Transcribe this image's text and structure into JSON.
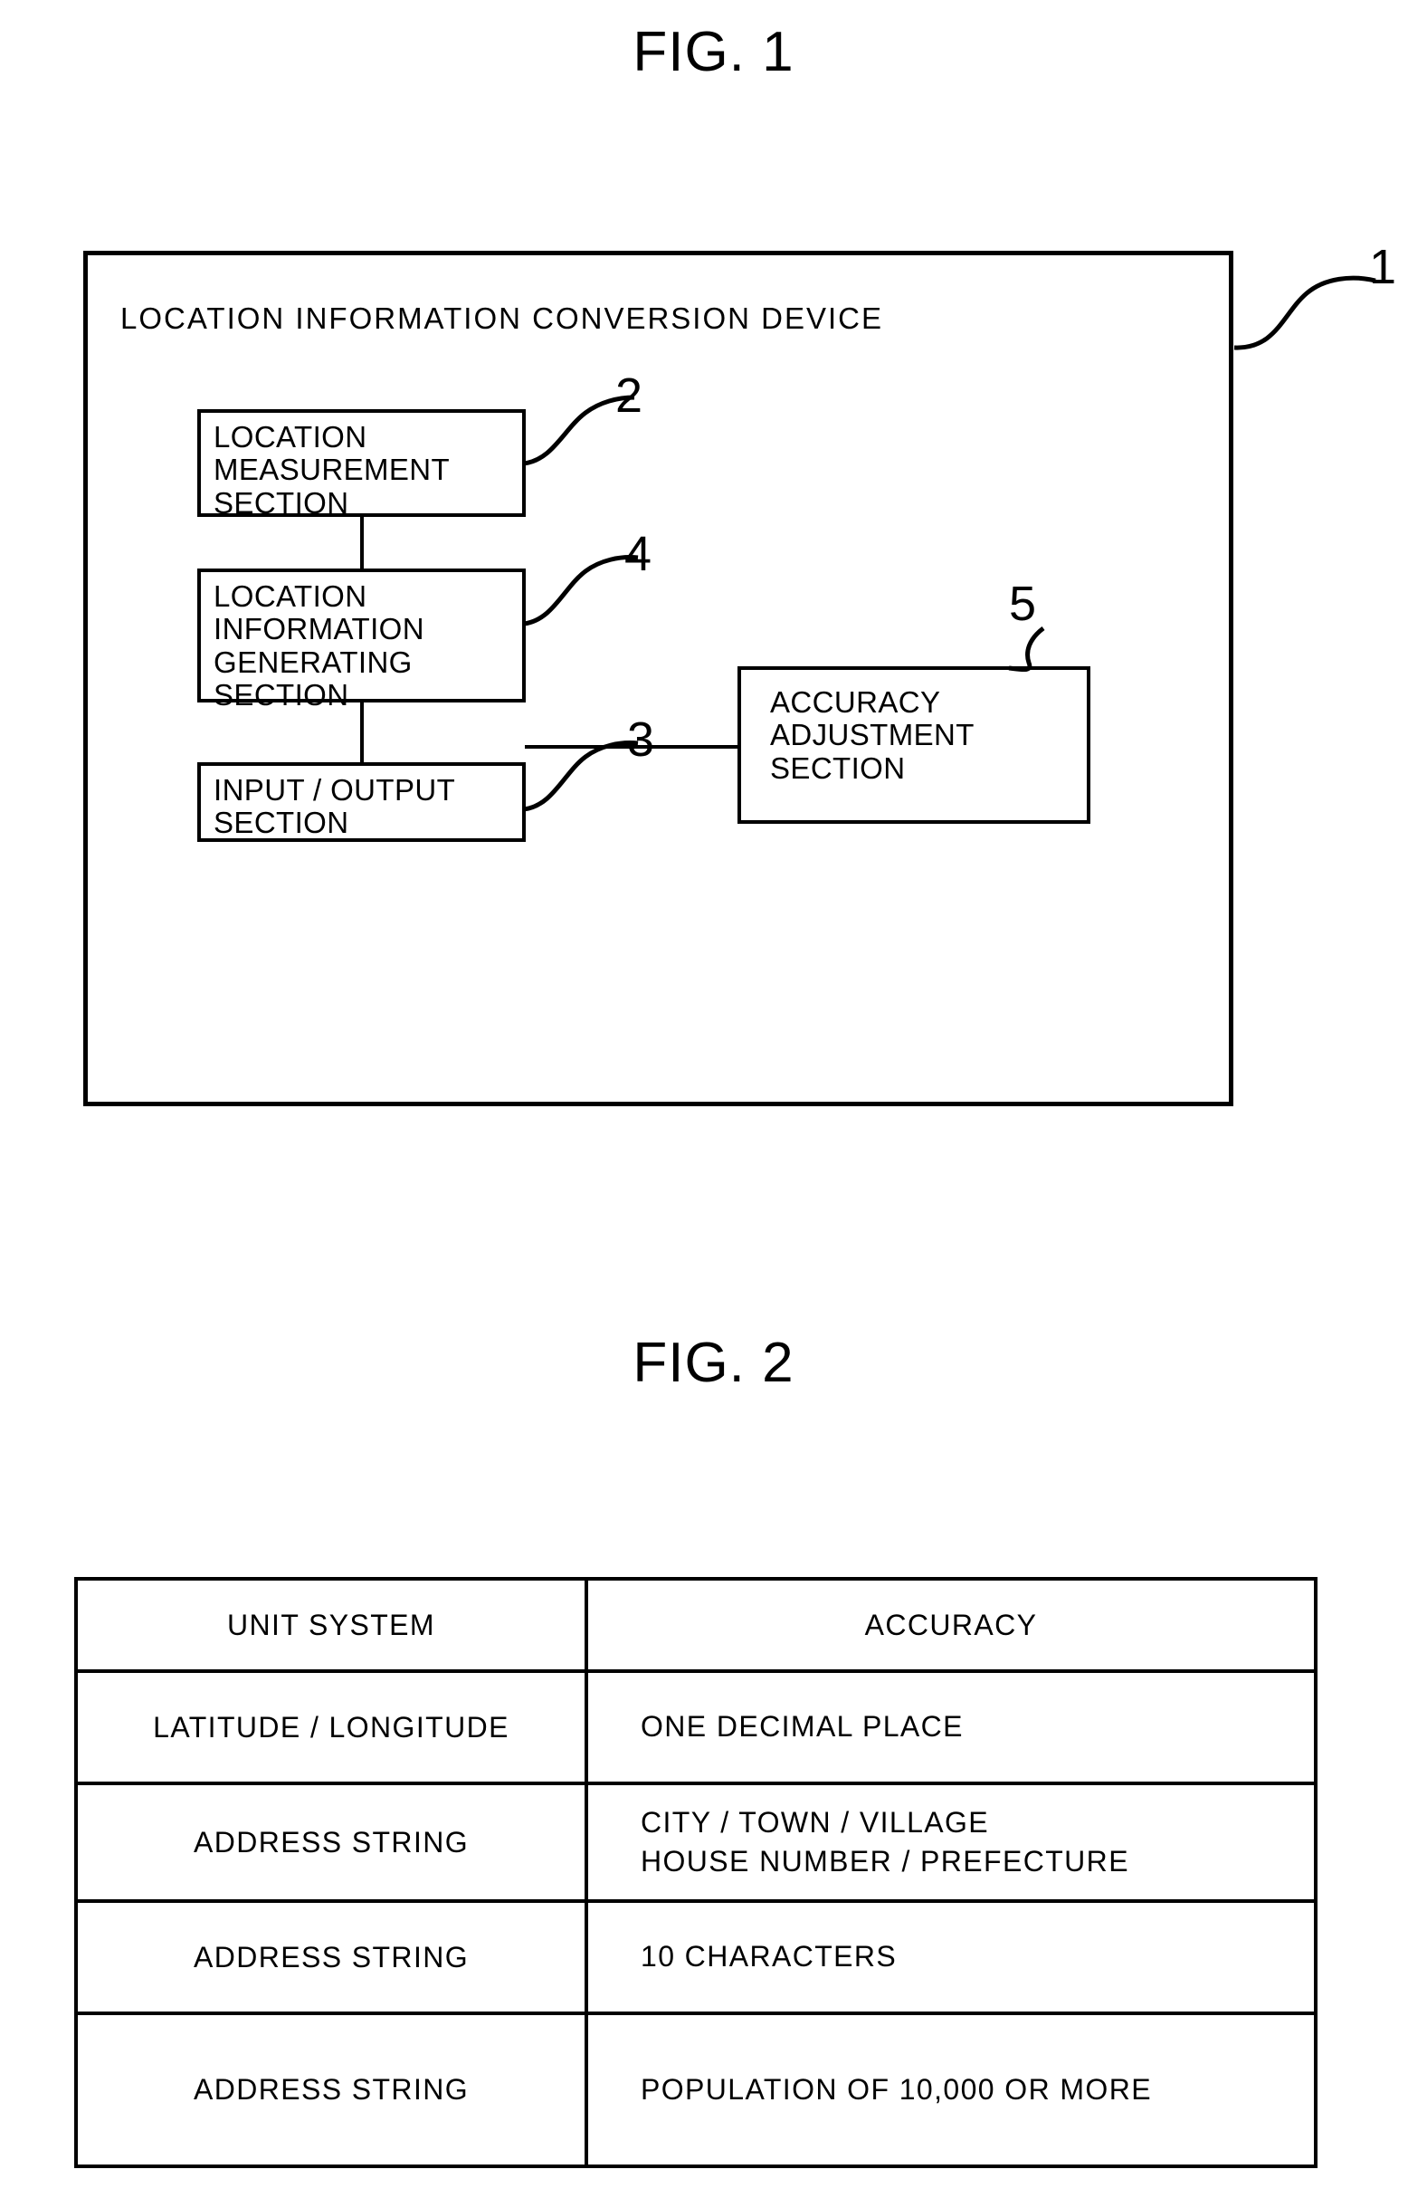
{
  "figures": {
    "fig1": {
      "title": "FIG. 1",
      "device_label": "LOCATION  INFORMATION  CONVERSION  DEVICE",
      "device_ref": "1",
      "blocks": [
        {
          "ref": "2",
          "lines": [
            "LOCATION",
            "MEASUREMENT",
            "SECTION"
          ]
        },
        {
          "ref": "4",
          "lines": [
            "LOCATION",
            "INFORMATION",
            "GENERATING",
            "SECTION"
          ]
        },
        {
          "ref": "3",
          "lines": [
            "INPUT / OUTPUT",
            "SECTION"
          ]
        },
        {
          "ref": "5",
          "lines": [
            "ACCURACY",
            "ADJUSTMENT",
            "SECTION"
          ]
        }
      ]
    },
    "fig2": {
      "title": "FIG. 2",
      "table": {
        "headers": [
          "UNIT  SYSTEM",
          "ACCURACY"
        ],
        "rows": [
          {
            "unit_system": "LATITUDE / LONGITUDE",
            "accuracy_lines": [
              "ONE  DECIMAL  PLACE"
            ]
          },
          {
            "unit_system": "ADDRESS  STRING",
            "accuracy_lines": [
              "CITY / TOWN / VILLAGE",
              "HOUSE  NUMBER / PREFECTURE"
            ]
          },
          {
            "unit_system": "ADDRESS  STRING",
            "accuracy_lines": [
              "10  CHARACTERS"
            ]
          },
          {
            "unit_system": "ADDRESS  STRING",
            "accuracy_lines": [
              "POPULATION  OF  10,000  OR  MORE"
            ]
          }
        ]
      }
    }
  },
  "colors": {
    "ink": "#000000",
    "paper": "#ffffff"
  }
}
